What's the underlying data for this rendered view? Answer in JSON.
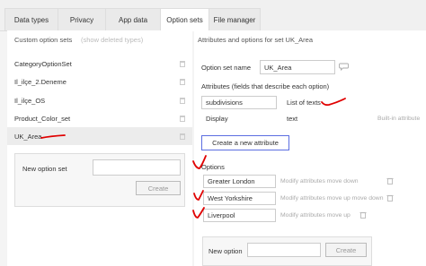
{
  "tabs": [
    {
      "label": "Data types",
      "active": false
    },
    {
      "label": "Privacy",
      "active": false
    },
    {
      "label": "App data",
      "active": false
    },
    {
      "label": "Option sets",
      "active": true
    },
    {
      "label": "File manager",
      "active": false
    }
  ],
  "left": {
    "header": "Custom option sets",
    "show_deleted": "(show deleted types)",
    "sets": [
      "CategoryOptionSet",
      "Il_ilçe_2.Deneme",
      "Il_ilçe_OS",
      "Product_Color_set",
      "UK_Area"
    ],
    "new_label": "New option set",
    "new_value": "",
    "create_label": "Create"
  },
  "right": {
    "header": "Attributes and options for set UK_Area",
    "name_label": "Option set name",
    "name_value": "UK_Area",
    "attributes_label": "Attributes (fields that describe each option)",
    "attributes": [
      {
        "name": "subdivisions",
        "type": "List of texts",
        "note": ""
      },
      {
        "name": "Display",
        "type": "text",
        "note": "Built-in attribute"
      }
    ],
    "create_attribute": "Create a new attribute",
    "options_label": "Options",
    "options": [
      {
        "value": "Greater London",
        "actions": "Modify attributes   move down"
      },
      {
        "value": "West Yorkshire",
        "actions": "Modify attributes   move up   move down"
      },
      {
        "value": "Liverpool",
        "actions": "Modify attributes   move up"
      }
    ],
    "new_option_label": "New option",
    "new_option_value": "",
    "create_label": "Create"
  },
  "colors": {
    "annotation": "#e00000",
    "accent": "#5b6ee1"
  }
}
